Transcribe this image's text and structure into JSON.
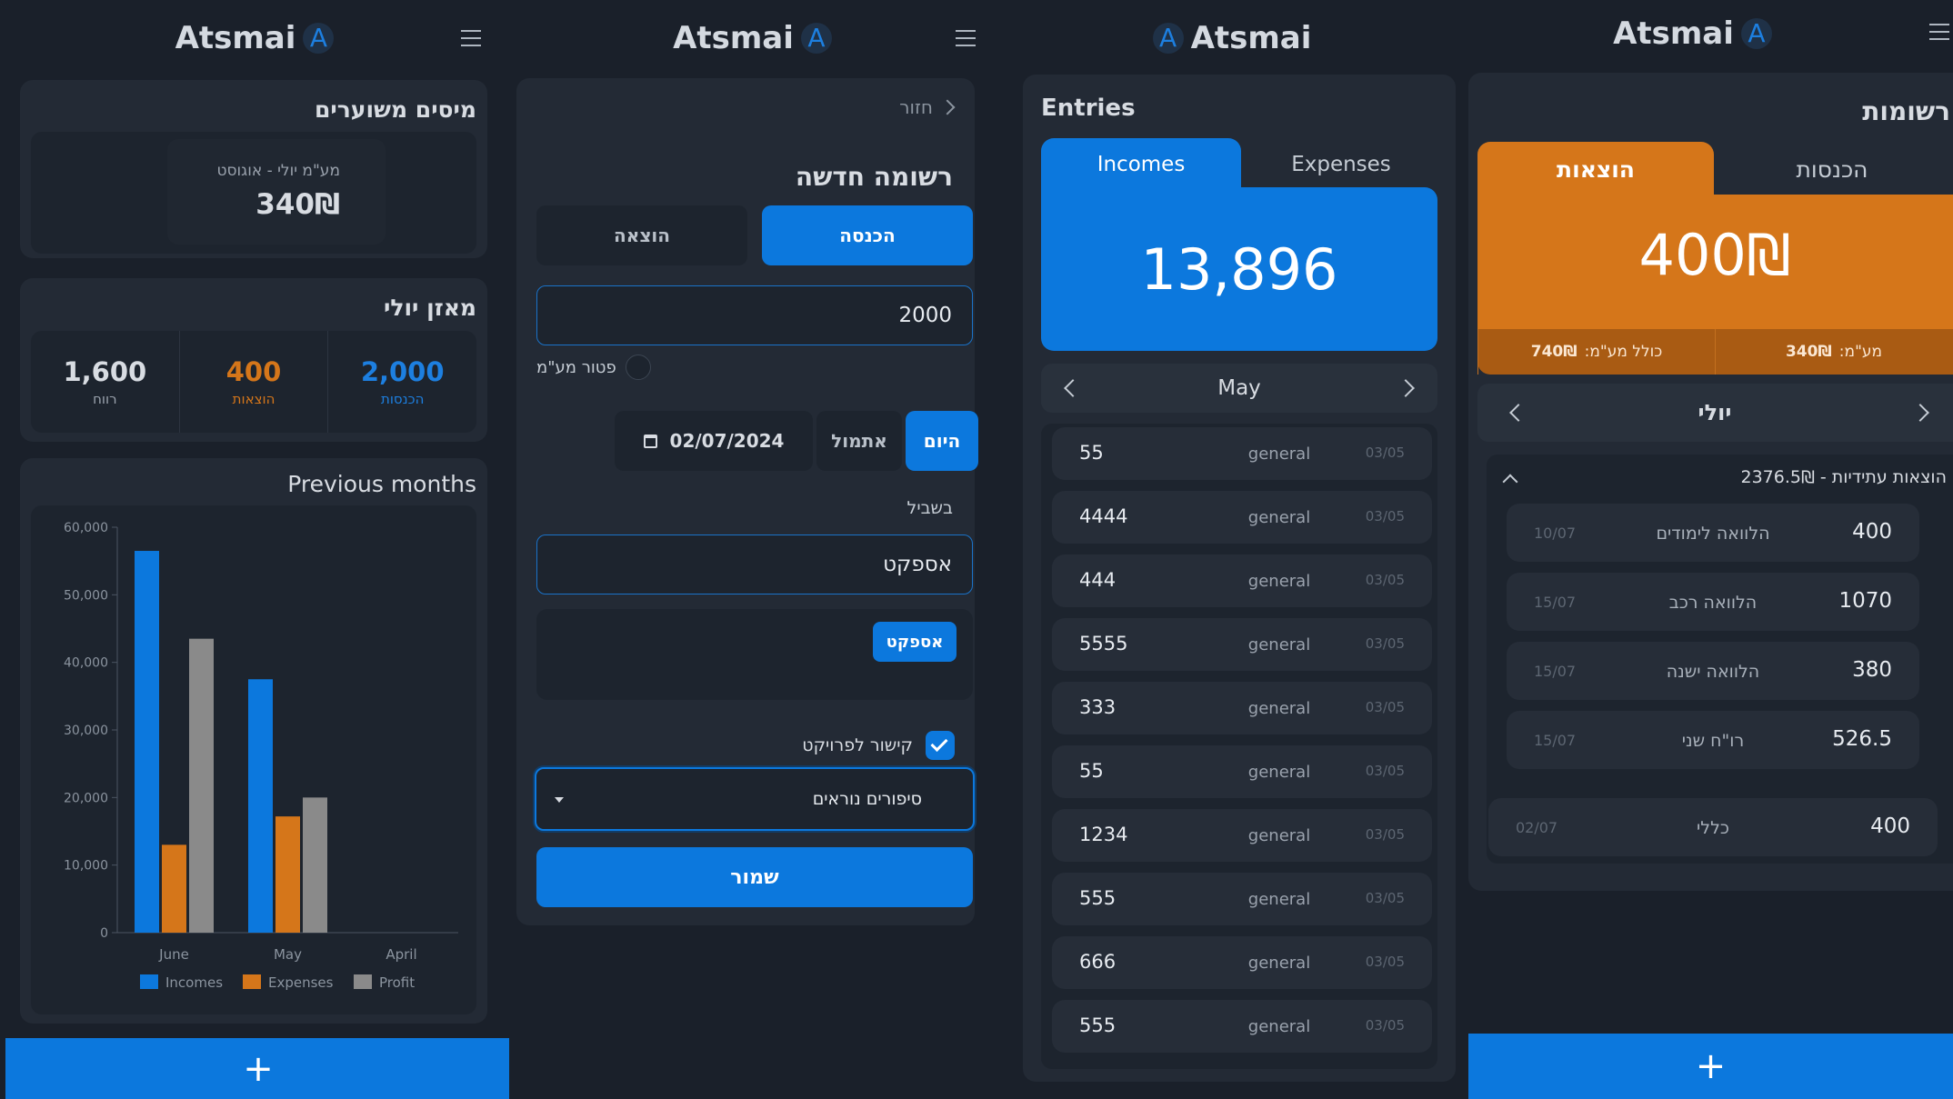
{
  "app": {
    "name": "Atsmai",
    "logo_letter": "A"
  },
  "colors": {
    "accent": "#0c78dd",
    "expense": "#d5761a",
    "profit": "#8a8a8a",
    "bg": "#1a202a",
    "card": "#232a35"
  },
  "p1": {
    "vat_title": "מיסים משוערים",
    "vat_label": "מע\"מ יולי - אוגוסט",
    "vat_amount": "340₪",
    "balance_title": "מאזן יולי",
    "stats": [
      {
        "value": "1,600",
        "label": "רווח",
        "color": "#d8dce2"
      },
      {
        "value": "400",
        "label": "הוצאות",
        "color": "#d5761a"
      },
      {
        "value": "2,000",
        "label": "הכנסות",
        "color": "#1d7fe0"
      }
    ],
    "prev_title": "Previous months",
    "fab_label": "+"
  },
  "chart_data": {
    "type": "bar",
    "title": "Previous months",
    "categories": [
      "June",
      "May",
      "April"
    ],
    "series": [
      {
        "name": "Incomes",
        "values": [
          56500,
          37500,
          0
        ],
        "color": "#0c78dd"
      },
      {
        "name": "Expenses",
        "values": [
          13000,
          17200,
          0
        ],
        "color": "#d5761a"
      },
      {
        "name": "Profit",
        "values": [
          43500,
          20000,
          0
        ],
        "color": "#8a8a8a"
      }
    ],
    "ylim": [
      0,
      60000
    ],
    "yticks": [
      "60,000",
      "50,000",
      "40,000",
      "30,000",
      "20,000",
      "10,000",
      "0"
    ],
    "legend": "bottom",
    "grid": false
  },
  "p2": {
    "back_label": "חזור",
    "form_title": "רשומה חדשה",
    "type_income": "הכנסה",
    "type_expense": "הוצאה",
    "amount_value": "2000",
    "vat_exempt_label": "פטור מע\"מ",
    "today_label": "היום",
    "yesterday_label": "אתמול",
    "date_value": "02/07/2024",
    "for_label": "בשביל",
    "for_value": "אספקט",
    "chip_label": "אספקט",
    "link_project_label": "קישור לפרויקט",
    "project_value": "סיפורים נוראים",
    "save_label": "שמור"
  },
  "p3": {
    "title": "Entries",
    "tab_incomes": "Incomes",
    "tab_expenses": "Expenses",
    "total": "13,896",
    "month": "May",
    "entries": [
      {
        "amount": "55",
        "category": "general",
        "date": "03/05"
      },
      {
        "amount": "4444",
        "category": "general",
        "date": "03/05"
      },
      {
        "amount": "444",
        "category": "general",
        "date": "03/05"
      },
      {
        "amount": "5555",
        "category": "general",
        "date": "03/05"
      },
      {
        "amount": "333",
        "category": "general",
        "date": "03/05"
      },
      {
        "amount": "55",
        "category": "general",
        "date": "03/05"
      },
      {
        "amount": "1234",
        "category": "general",
        "date": "03/05"
      },
      {
        "amount": "555",
        "category": "general",
        "date": "03/05"
      },
      {
        "amount": "666",
        "category": "general",
        "date": "03/05"
      },
      {
        "amount": "555",
        "category": "general",
        "date": "03/05"
      }
    ]
  },
  "p4": {
    "title": "רשומות",
    "tab_expenses": "הוצאות",
    "tab_incomes": "הכנסות",
    "total": "400₪",
    "vat_label": "מע\"מ:",
    "vat_value": "340₪",
    "incl_vat_label": "כולל מע\"מ:",
    "incl_vat_value": "740₪",
    "month": "יולי",
    "future_title": "הוצאות עתידיות - 2376.5₪",
    "future": [
      {
        "amount": "400",
        "label": "הלוואה לימודים",
        "date": "10/07"
      },
      {
        "amount": "1070",
        "label": "הלוואה רכב",
        "date": "15/07"
      },
      {
        "amount": "380",
        "label": "הלוואה ישנה",
        "date": "15/07"
      },
      {
        "amount": "526.5",
        "label": "רו\"ח שני",
        "date": "15/07"
      }
    ],
    "entry": {
      "amount": "400",
      "label": "כללי",
      "date": "02/07"
    },
    "fab_label": "+"
  }
}
